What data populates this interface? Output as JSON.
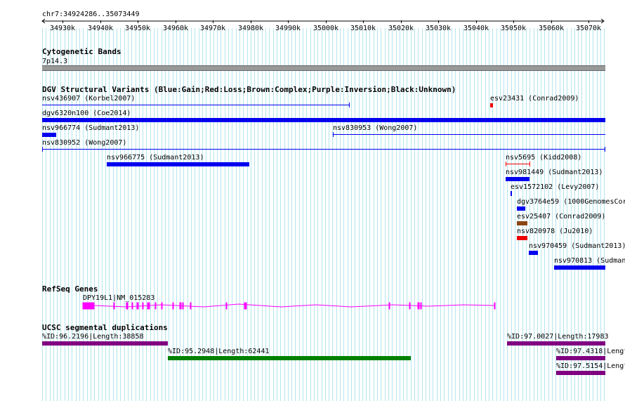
{
  "ruler": {
    "coords": "chr7:34924286..35073449",
    "ticks": [
      "34930k",
      "34940k",
      "34950k",
      "34960k",
      "34970k",
      "34980k",
      "34990k",
      "35000k",
      "35010k",
      "35020k",
      "35030k",
      "35040k",
      "35050k",
      "35060k",
      "35070k"
    ]
  },
  "tracks": {
    "cytoband": {
      "title": "Cytogenetic Bands",
      "band": "7p14.3"
    },
    "dgv": {
      "title": "DGV Structural Variants (Blue:Gain;Red:Loss;Brown:Complex;Purple:Inversion;Black:Unknown)",
      "features": [
        {
          "label": "nsv436907 (Korbel2007)"
        },
        {
          "label": "esv23431 (Conrad2009)"
        },
        {
          "label": "dgv6320n100 (Coe2014)"
        },
        {
          "label": "nsv966774 (Sudmant2013)"
        },
        {
          "label": "nsv830953 (Wong2007)"
        },
        {
          "label": "nsv830952 (Wong2007)"
        },
        {
          "label": "nsv966775 (Sudmant2013)"
        },
        {
          "label": "nsv5695 (Kidd2008)"
        },
        {
          "label": "nsv981449 (Sudmant2013)"
        },
        {
          "label": "esv1572102 (Levy2007)"
        },
        {
          "label": "dgv3764e59 (1000GenomesCor"
        },
        {
          "label": "esv25407 (Conrad2009)"
        },
        {
          "label": "nsv820978 (Ju2010)"
        },
        {
          "label": "nsv970459 (Sudmant2013)"
        },
        {
          "label": "nsv970813 (Sudman"
        }
      ]
    },
    "refseq": {
      "title": "RefSeq Genes",
      "gene": "DPY19L1|NM_015283"
    },
    "segdup": {
      "title": "UCSC segmental duplications",
      "features": [
        {
          "label": "%ID:96.2196|Length:38858"
        },
        {
          "label": "%ID:95.2948|Length:62441"
        },
        {
          "label": "%ID:97.0027|Length:17983"
        },
        {
          "label": "%ID:97.4318|Lengt"
        },
        {
          "label": "%ID:97.5154|Lengt"
        }
      ]
    }
  },
  "colors": {
    "gain": "#0000ee",
    "loss": "#ee0000",
    "complex": "#8b4513",
    "inversion": "#800080",
    "gene": "#ff00ff",
    "segdup_purple": "#800080",
    "segdup_green": "#008000",
    "grid_line": "#b3e5ee",
    "cytoband": "#999999"
  }
}
